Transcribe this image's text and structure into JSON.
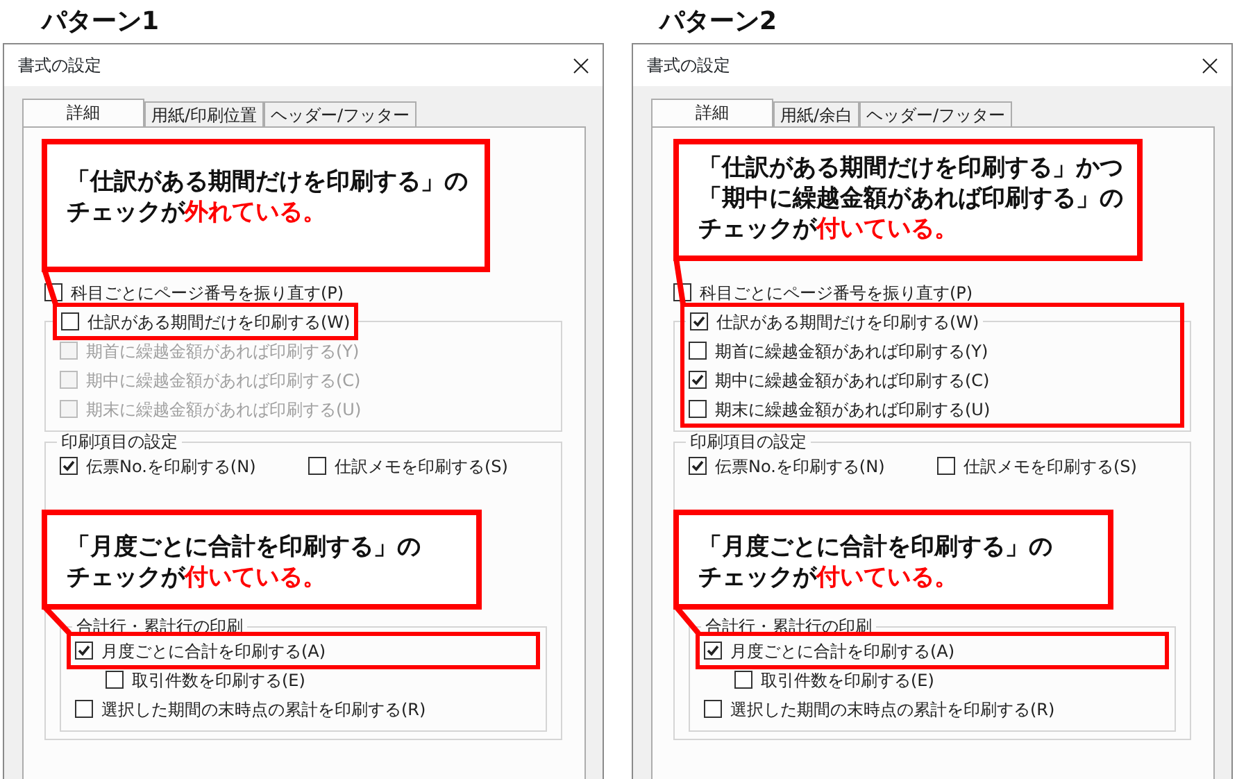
{
  "panels": [
    {
      "heading": "パターン1",
      "dialog": {
        "title": "書式の設定",
        "tabs": [
          {
            "label": "詳細",
            "selected": true
          },
          {
            "label": "用紙/印刷位置",
            "selected": false
          },
          {
            "label": "ヘッダー/フッター",
            "selected": false
          }
        ],
        "options": [
          {
            "label": "科目ごとにページ番号を振り直す(P)",
            "checked": false,
            "disabled": false
          },
          {
            "label": "仕訳がある期間だけを印刷する(W)",
            "checked": false,
            "disabled": false,
            "highlighted": true,
            "children": [
              {
                "label": "期首に繰越金額があれば印刷する(Y)",
                "checked": false,
                "disabled": true
              },
              {
                "label": "期中に繰越金額があれば印刷する(C)",
                "checked": false,
                "disabled": true
              },
              {
                "label": "期末に繰越金額があれば印刷する(U)",
                "checked": false,
                "disabled": true
              }
            ]
          }
        ],
        "print_items": {
          "title": "印刷項目の設定",
          "items": [
            {
              "label": "伝票No.を印刷する(N)",
              "checked": true,
              "disabled": false
            },
            {
              "label": "仕訳メモを印刷する(S)",
              "checked": false,
              "disabled": false
            }
          ],
          "total_rows": {
            "title": "合計行・累計行の印刷",
            "items": [
              {
                "label": "月度ごとに合計を印刷する(A)",
                "checked": true,
                "disabled": false,
                "highlighted": true,
                "children": [
                  {
                    "label": "取引件数を印刷する(E)",
                    "checked": false,
                    "disabled": false
                  }
                ]
              },
              {
                "label": "選択した期間の末時点の累計を印刷する(R)",
                "checked": false,
                "disabled": false
              }
            ]
          }
        }
      },
      "callouts": [
        {
          "lines": [
            [
              {
                "text": "「仕訳がある期間だけを印刷する」の",
                "emphasis": false
              }
            ],
            [
              {
                "text": "チェックが",
                "emphasis": false
              },
              {
                "text": "外れている。",
                "emphasis": true
              }
            ]
          ]
        },
        {
          "lines": [
            [
              {
                "text": "「月度ごとに合計を印刷する」の",
                "emphasis": false
              }
            ],
            [
              {
                "text": "チェックが",
                "emphasis": false
              },
              {
                "text": "付いている。",
                "emphasis": true
              }
            ]
          ]
        }
      ]
    },
    {
      "heading": "パターン2",
      "dialog": {
        "title": "書式の設定",
        "tabs": [
          {
            "label": "詳細",
            "selected": true
          },
          {
            "label": "用紙/余白",
            "selected": false
          },
          {
            "label": "ヘッダー/フッター",
            "selected": false
          }
        ],
        "options": [
          {
            "label": "科目ごとにページ番号を振り直す(P)",
            "checked": false,
            "disabled": false
          },
          {
            "label": "仕訳がある期間だけを印刷する(W)",
            "checked": true,
            "disabled": false,
            "highlighted": true,
            "highlight_includes_children": true,
            "children": [
              {
                "label": "期首に繰越金額があれば印刷する(Y)",
                "checked": false,
                "disabled": false
              },
              {
                "label": "期中に繰越金額があれば印刷する(C)",
                "checked": true,
                "disabled": false
              },
              {
                "label": "期末に繰越金額があれば印刷する(U)",
                "checked": false,
                "disabled": false
              }
            ]
          }
        ],
        "print_items": {
          "title": "印刷項目の設定",
          "items": [
            {
              "label": "伝票No.を印刷する(N)",
              "checked": true,
              "disabled": false
            },
            {
              "label": "仕訳メモを印刷する(S)",
              "checked": false,
              "disabled": false
            }
          ],
          "total_rows": {
            "title": "合計行・累計行の印刷",
            "items": [
              {
                "label": "月度ごとに合計を印刷する(A)",
                "checked": true,
                "disabled": false,
                "highlighted": true,
                "children": [
                  {
                    "label": "取引件数を印刷する(E)",
                    "checked": false,
                    "disabled": false
                  }
                ]
              },
              {
                "label": "選択した期間の末時点の累計を印刷する(R)",
                "checked": false,
                "disabled": false
              }
            ]
          }
        }
      },
      "callouts": [
        {
          "lines": [
            [
              {
                "text": "「仕訳がある期間だけを印刷する」かつ",
                "emphasis": false
              }
            ],
            [
              {
                "text": "「期中に繰越金額があれば印刷する」の",
                "emphasis": false
              }
            ],
            [
              {
                "text": "チェックが",
                "emphasis": false
              },
              {
                "text": "付いている。",
                "emphasis": true
              }
            ]
          ]
        },
        {
          "lines": [
            [
              {
                "text": "「月度ごとに合計を印刷する」の",
                "emphasis": false
              }
            ],
            [
              {
                "text": "チェックが",
                "emphasis": false
              },
              {
                "text": "付いている。",
                "emphasis": true
              }
            ]
          ]
        }
      ]
    }
  ]
}
